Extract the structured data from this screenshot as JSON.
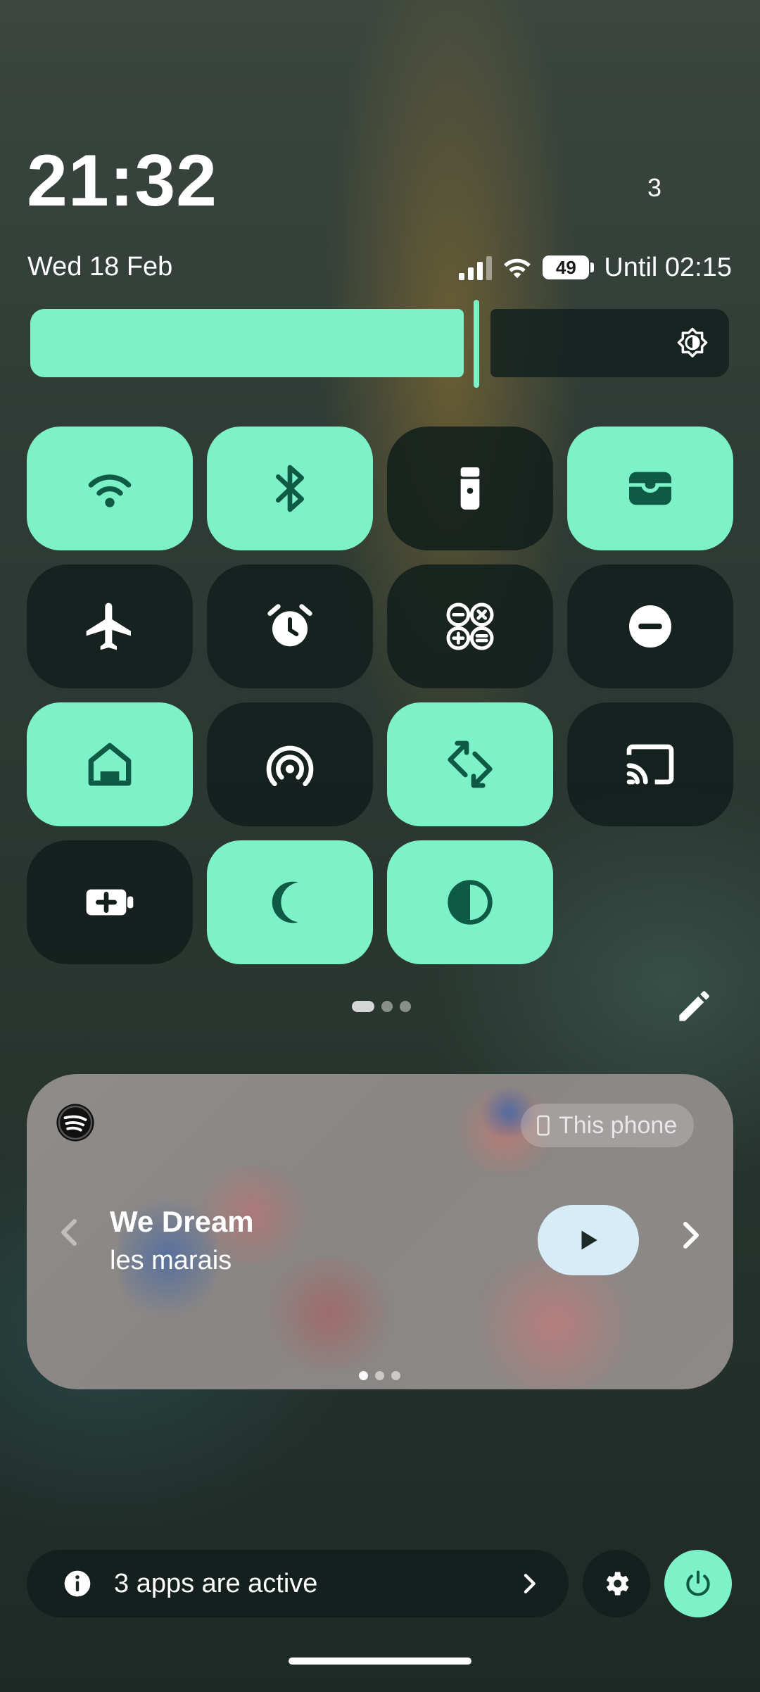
{
  "status": {
    "time": "21:32",
    "notification_count": "3",
    "date": "Wed 18 Feb",
    "battery_percent": "49",
    "battery_until": "Until 02:15"
  },
  "brightness": {
    "level": 0.63
  },
  "tiles": [
    {
      "name": "wifi",
      "on": true
    },
    {
      "name": "bluetooth",
      "on": true
    },
    {
      "name": "flashlight",
      "on": false
    },
    {
      "name": "wallet",
      "on": true
    },
    {
      "name": "airplane-mode",
      "on": false
    },
    {
      "name": "alarm",
      "on": false
    },
    {
      "name": "calculator",
      "on": false
    },
    {
      "name": "do-not-disturb",
      "on": false
    },
    {
      "name": "home",
      "on": true
    },
    {
      "name": "hotspot",
      "on": false
    },
    {
      "name": "auto-rotate",
      "on": true
    },
    {
      "name": "screen-cast",
      "on": false
    },
    {
      "name": "battery-saver",
      "on": false
    },
    {
      "name": "dark-theme",
      "on": true
    },
    {
      "name": "color-inversion",
      "on": true
    }
  ],
  "qs_pages": {
    "count": 3,
    "active": 0
  },
  "media": {
    "app_icon": "spotify-icon",
    "output_device": "This phone",
    "title": "We Dream",
    "artist": "les marais",
    "pages": {
      "count": 3,
      "active": 0
    }
  },
  "footer": {
    "active_apps_text": "3 apps are active"
  },
  "colors": {
    "accent": "#7df2c8",
    "tile_off": "#131f1d",
    "icon_on": "#0f5a45",
    "icon_off": "#ffffff"
  }
}
